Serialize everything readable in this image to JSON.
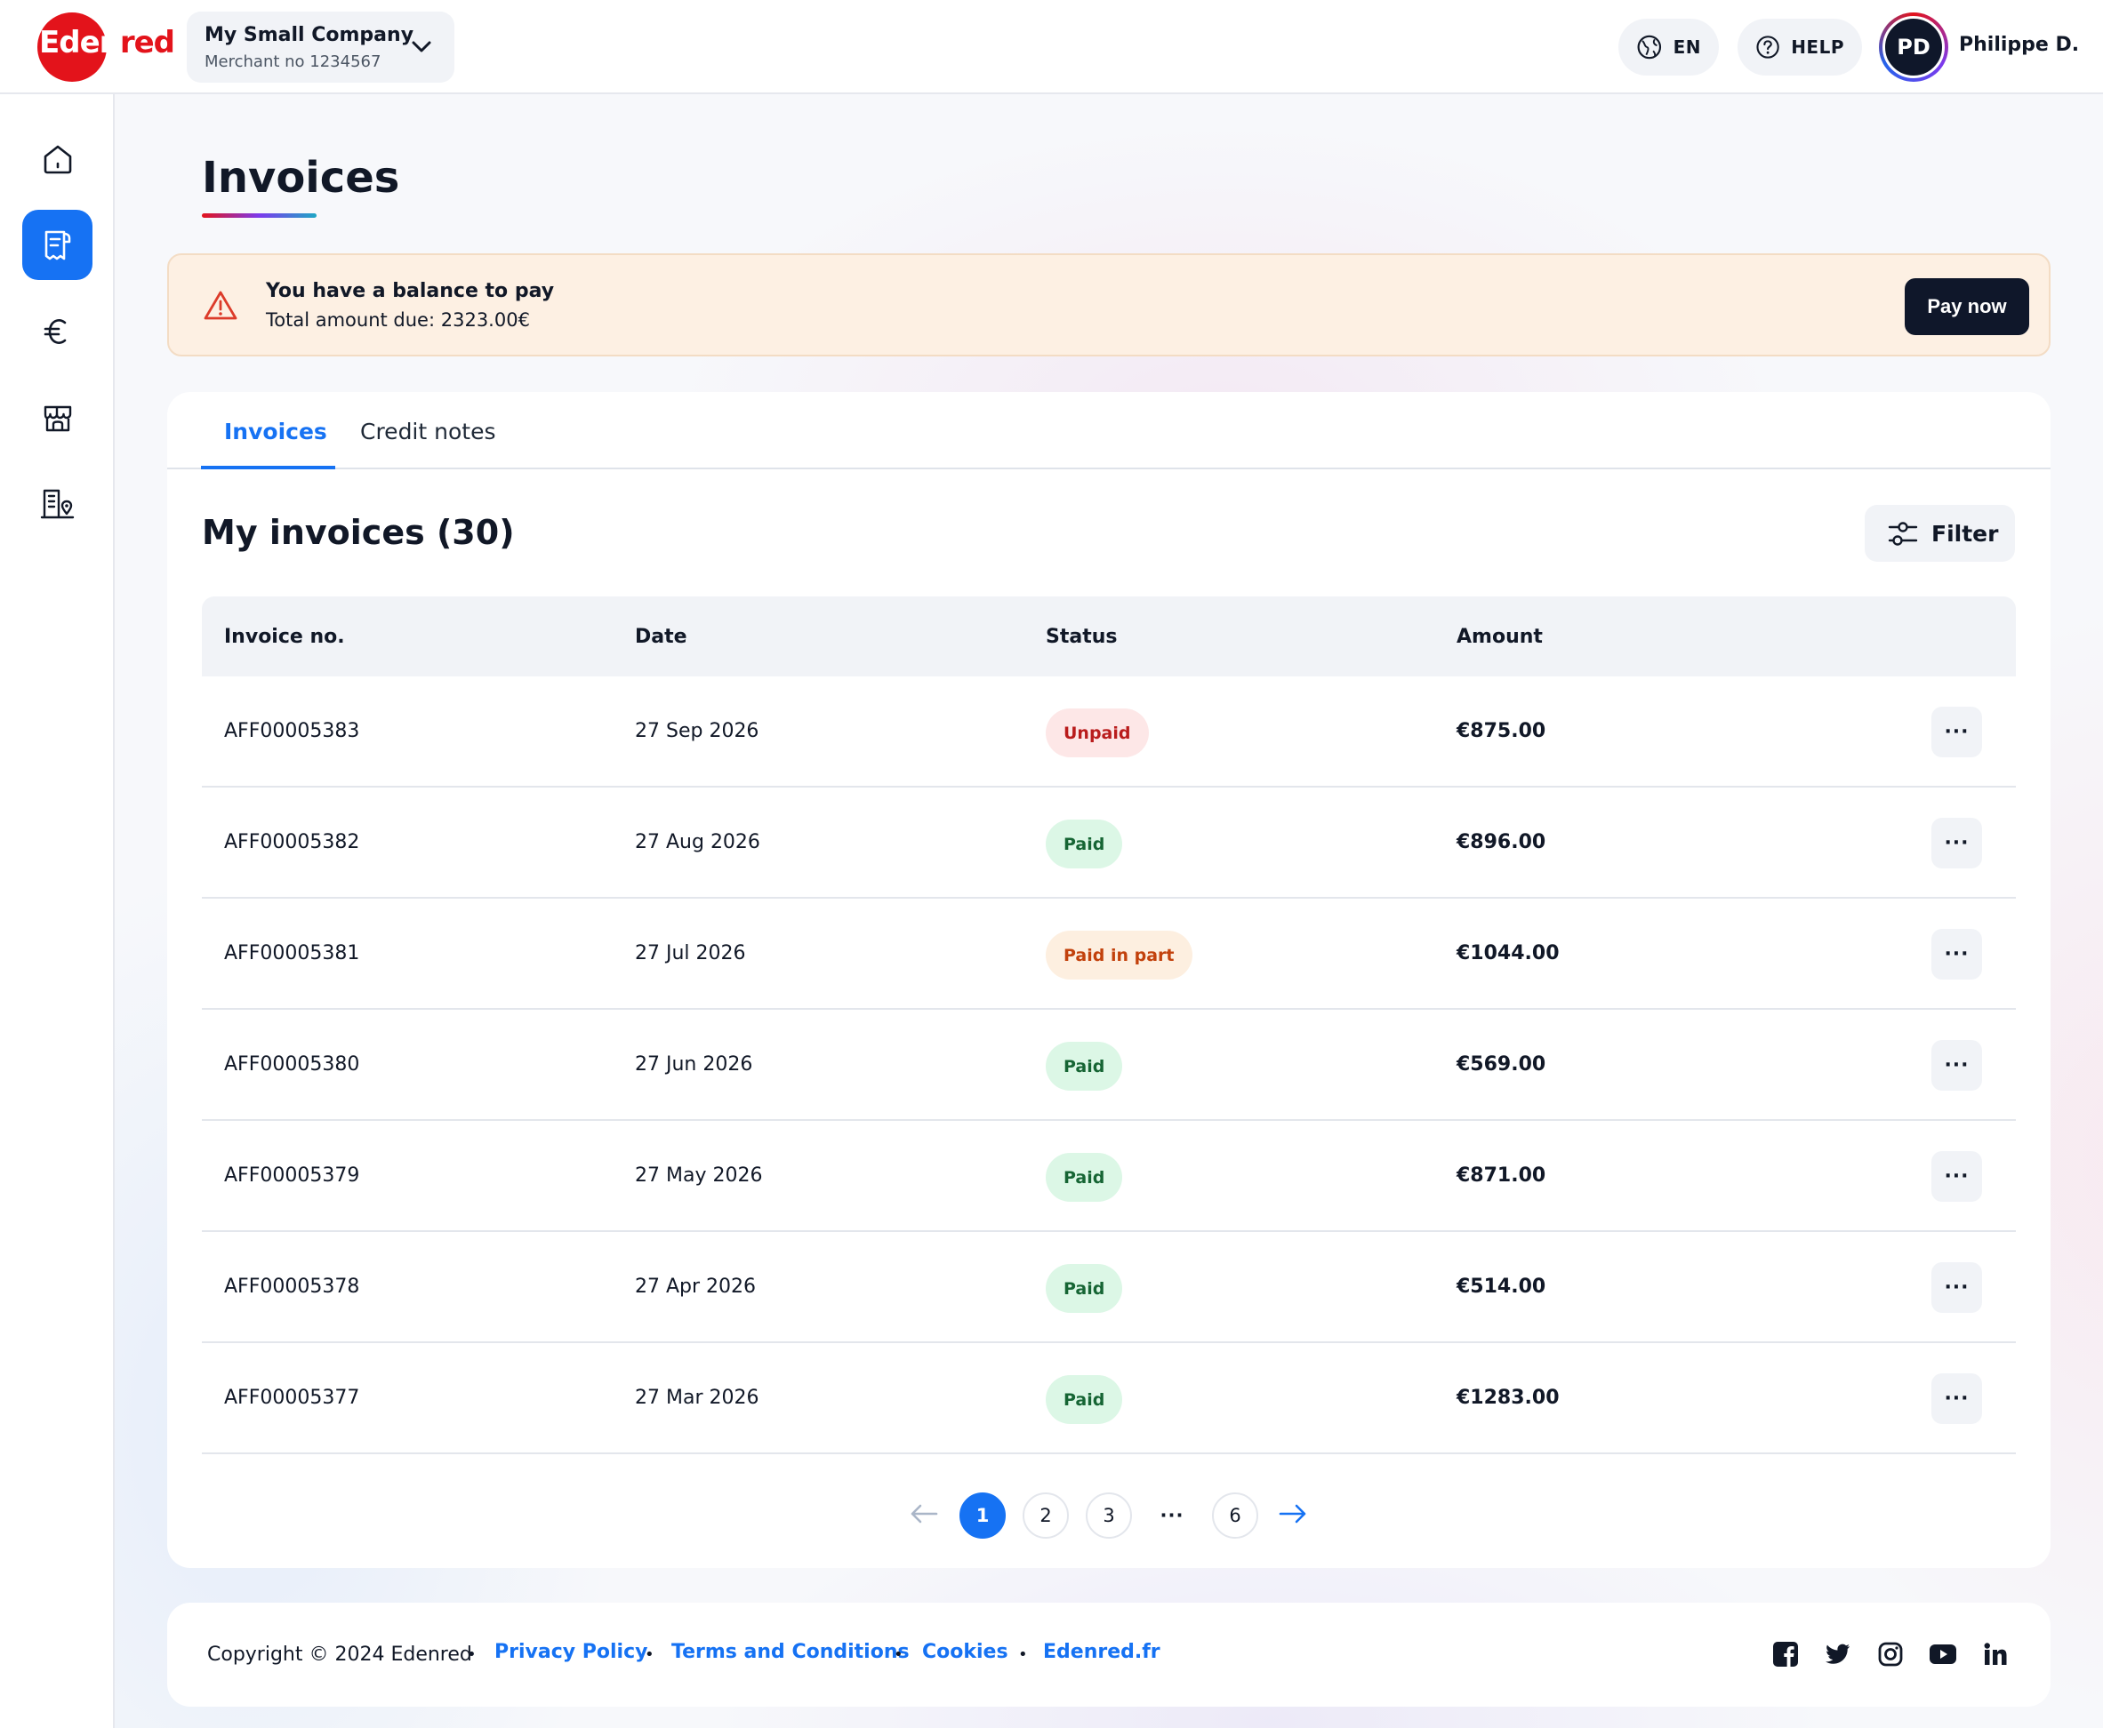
{
  "brand": {
    "logo_text_white": "Eden",
    "logo_text_red": "red",
    "accent": "#e3131b",
    "primary": "#1672f3"
  },
  "header": {
    "company_name": "My Small Company",
    "merchant_no": "Merchant no 1234567",
    "language": "EN",
    "help": "HELP",
    "avatar_initials": "PD",
    "user_name": "Philippe D."
  },
  "sidebar": {
    "items": [
      {
        "icon": "home-icon",
        "active": false
      },
      {
        "icon": "invoice-icon",
        "active": true
      },
      {
        "icon": "euro-icon",
        "active": false
      },
      {
        "icon": "store-icon",
        "active": false
      },
      {
        "icon": "building-location-icon",
        "active": false
      }
    ]
  },
  "page": {
    "title": "Invoices"
  },
  "alert": {
    "title": "You have a balance to pay",
    "subtitle": "Total amount due: 2323.00€",
    "button": "Pay now"
  },
  "tabs": [
    {
      "label": "Invoices",
      "active": true
    },
    {
      "label": "Credit notes",
      "active": false
    }
  ],
  "list": {
    "title": "My invoices (30)",
    "filter_label": "Filter",
    "columns": [
      "Invoice no.",
      "Date",
      "Status",
      "Amount"
    ],
    "rows": [
      {
        "invoice_no": "AFF00005383",
        "date": "27 Sep 2026",
        "status": "Unpaid",
        "amount": "€875.00",
        "more": "···"
      },
      {
        "invoice_no": "AFF00005382",
        "date": "27 Aug 2026",
        "status": "Paid",
        "amount": "€896.00",
        "more": "···"
      },
      {
        "invoice_no": "AFF00005381",
        "date": "27 Jul 2026",
        "status": "Paid in part",
        "amount": "€1044.00",
        "more": "···"
      },
      {
        "invoice_no": "AFF00005380",
        "date": "27 Jun 2026",
        "status": "Paid",
        "amount": "€569.00",
        "more": "···"
      },
      {
        "invoice_no": "AFF00005379",
        "date": "27 May 2026",
        "status": "Paid",
        "amount": "€871.00",
        "more": "···"
      },
      {
        "invoice_no": "AFF00005378",
        "date": "27 Apr 2026",
        "status": "Paid",
        "amount": "€514.00",
        "more": "···"
      },
      {
        "invoice_no": "AFF00005377",
        "date": "27 Mar 2026",
        "status": "Paid",
        "amount": "€1283.00",
        "more": "···"
      }
    ],
    "status_colors": {
      "Unpaid": {
        "bg": "#fde7e7",
        "fg": "#b91c1c"
      },
      "Paid": {
        "bg": "#dcf7e6",
        "fg": "#166534"
      },
      "Paid in part": {
        "bg": "#fdefe0",
        "fg": "#c2410c"
      }
    }
  },
  "pagination": {
    "pages": [
      "1",
      "2",
      "3",
      "···",
      "6"
    ],
    "current": "1"
  },
  "footer": {
    "copyright": "Copyright © 2024 Edenred",
    "separator": "•",
    "links": [
      "Privacy Policy",
      "Terms and Conditions",
      "Cookies",
      "Edenred.fr"
    ],
    "social": [
      "facebook-icon",
      "twitter-icon",
      "instagram-icon",
      "youtube-icon",
      "linkedin-icon"
    ]
  }
}
